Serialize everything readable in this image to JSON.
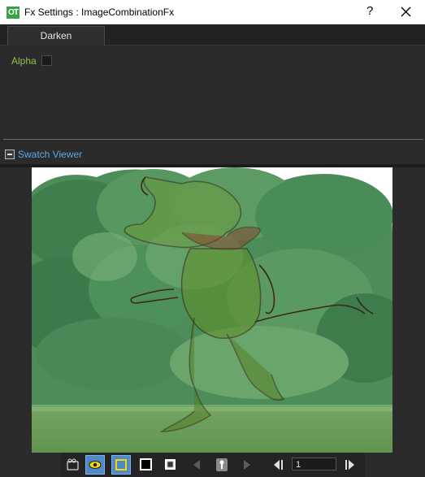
{
  "window": {
    "title": "Fx Settings : ImageCombinationFx",
    "icon_text": "OT",
    "help": "?"
  },
  "tabs": [
    {
      "label": "Darken",
      "selected": true
    }
  ],
  "params": {
    "alpha_label": "Alpha",
    "alpha_checked": false
  },
  "swatch": {
    "title": "Swatch Viewer"
  },
  "toolbar": {
    "frame_value": "1",
    "buttons": [
      "camera-icon",
      "eye-icon",
      "yellow-frame-icon",
      "black-bg-icon",
      "checker-bg-icon",
      "prev-arrow-icon",
      "key-icon",
      "next-arrow-icon",
      "first-frame-icon",
      "last-frame-icon"
    ]
  },
  "colors": {
    "accent_label": "#8bc34a",
    "swatch_title": "#5aa9e6",
    "active_button": "#4f89c9",
    "app_icon": "#3aa447"
  }
}
